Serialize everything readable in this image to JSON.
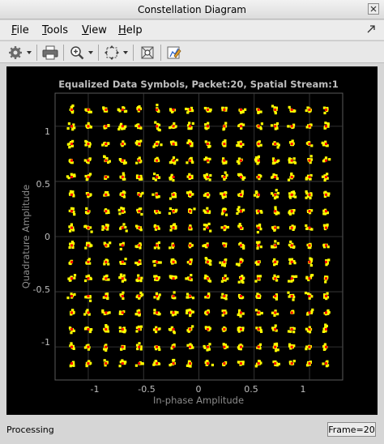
{
  "window": {
    "title": "Constellation Diagram"
  },
  "menu": {
    "file": {
      "accel": "F",
      "rest": "ile"
    },
    "tools": {
      "accel": "T",
      "rest": "ools"
    },
    "view": {
      "accel": "V",
      "rest": "iew"
    },
    "help": {
      "accel": "H",
      "rest": "elp"
    }
  },
  "toolbar": {
    "icons": [
      "settings-gear-icon",
      "dropdown-arrow-icon",
      "print-icon",
      "zoom-in-icon",
      "dropdown-arrow-icon",
      "scale-axes-icon",
      "data-cursor-icon",
      "style-pencil-icon"
    ]
  },
  "plot": {
    "title": "Equalized Data Symbols, Packet:20, Spatial Stream:1",
    "xlabel": "In-phase Amplitude",
    "ylabel": "Quadrature Amplitude",
    "xticks": [
      "-1",
      "-0.5",
      "0",
      "0.5",
      "1"
    ],
    "yticks": [
      "1",
      "0.5",
      "0",
      "-0.5",
      "-1"
    ],
    "colors": {
      "background": "#000000",
      "symbols": "#ffff00",
      "reference": "#ff0000",
      "grid": "#404040",
      "axis_text": "#bfbfbf"
    }
  },
  "chart_data": {
    "type": "scatter",
    "title": "Equalized Data Symbols, Packet:20, Spatial Stream:1",
    "xlabel": "In-phase Amplitude",
    "ylabel": "Quadrature Amplitude",
    "xlim": [
      -1.3,
      1.3
    ],
    "ylim": [
      -1.3,
      1.3
    ],
    "grid": true,
    "constellation_levels": [
      -1.15,
      -1.0,
      -0.84,
      -0.69,
      -0.54,
      -0.38,
      -0.23,
      -0.08,
      0.08,
      0.23,
      0.38,
      0.54,
      0.69,
      0.84,
      1.0,
      1.15
    ],
    "series": [
      {
        "name": "",
        "marker": "yellow dots",
        "description": "received symbols clustered around 256-QAM points"
      },
      {
        "name": "",
        "marker": "red",
        "description": "reference constellation points"
      }
    ]
  },
  "status": {
    "left": "Processing",
    "frame": "Frame=20"
  }
}
